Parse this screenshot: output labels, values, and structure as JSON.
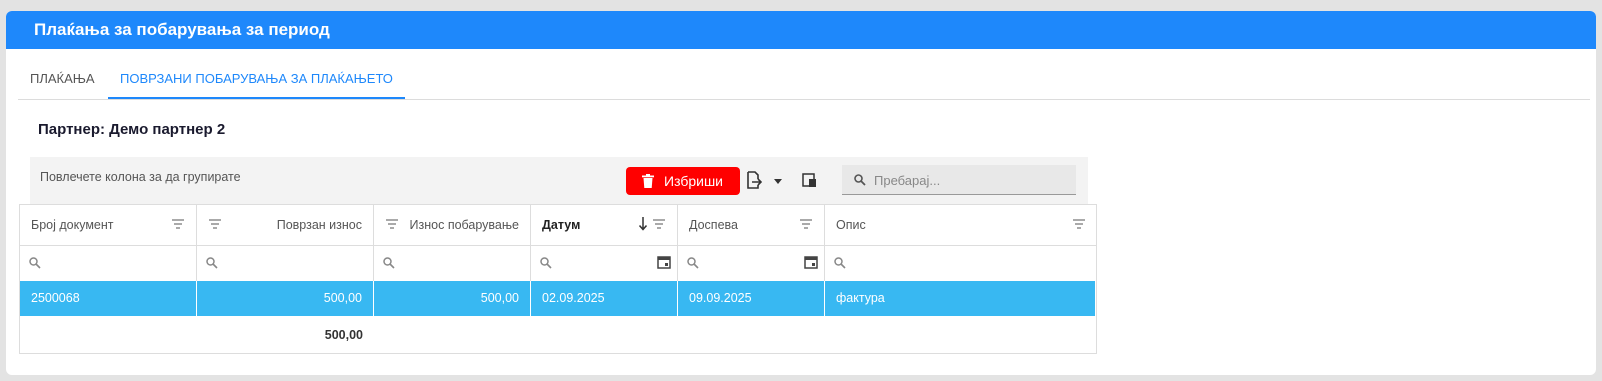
{
  "header": {
    "title": "Плаќања за побарувања за период"
  },
  "tabs": [
    {
      "label": "ПЛАЌАЊА",
      "active": false
    },
    {
      "label": "ПОВРЗАНИ ПОБАРУВАЊА ЗА ПЛАЌАЊЕТО",
      "active": true
    }
  ],
  "partner": {
    "label": "Партнер: Демо партнер 2"
  },
  "toolbar": {
    "group_hint": "Повлечете колона за да групирате",
    "delete_label": "Избриши",
    "search_placeholder": "Пребарај...",
    "delete_color": "#ff0000"
  },
  "grid": {
    "columns": [
      "Број документ",
      "Поврзан износ",
      "Износ побарување",
      "Датум",
      "Доспева",
      "Опис"
    ],
    "sort": {
      "column": "Датум",
      "direction": "descending"
    },
    "rows": [
      {
        "doc": "2500068",
        "linked": "500,00",
        "claim": "500,00",
        "date": "02.09.2025",
        "due": "09.09.2025",
        "desc": "фактура",
        "selected": true
      }
    ],
    "totals": {
      "linked": "500,00"
    }
  },
  "colors": {
    "accent": "#1e88fb",
    "selected_row": "#38b8f2"
  }
}
